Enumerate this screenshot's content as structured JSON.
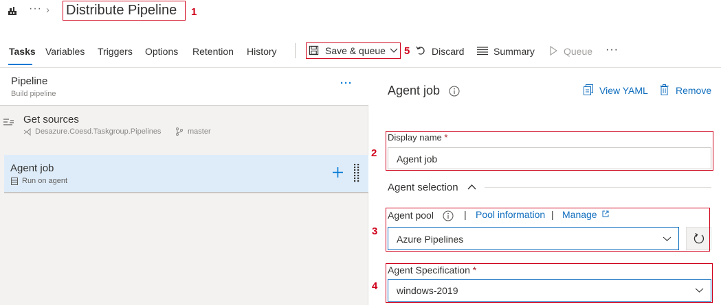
{
  "header": {
    "title": "Distribute Pipeline",
    "more": "···",
    "chevron": "›"
  },
  "tabs": [
    {
      "label": "Tasks",
      "active": true
    },
    {
      "label": "Variables"
    },
    {
      "label": "Triggers"
    },
    {
      "label": "Options"
    },
    {
      "label": "Retention"
    },
    {
      "label": "History"
    }
  ],
  "toolbar": {
    "save_queue": "Save & queue",
    "discard": "Discard",
    "summary": "Summary",
    "queue": "Queue",
    "more": "···"
  },
  "pipeline": {
    "title": "Pipeline",
    "subtitle": "Build pipeline",
    "more": "···"
  },
  "get_sources": {
    "title": "Get sources",
    "repo": "Desazure.Coesd.Taskgroup.Pipelines",
    "branch": "master"
  },
  "agent_job_item": {
    "title": "Agent job",
    "subtitle": "Run on agent"
  },
  "detail": {
    "title": "Agent job",
    "view_yaml": "View YAML",
    "remove": "Remove",
    "display_name_label": "Display name",
    "display_name_value": "Agent job",
    "agent_selection": "Agent selection",
    "agent_pool_label": "Agent pool",
    "pool_information": "Pool information",
    "manage": "Manage",
    "agent_pool_value": "Azure Pipelines",
    "agent_spec_label": "Agent Specification",
    "agent_spec_value": "windows-2019",
    "required_marker": "*",
    "link_sep": "|"
  },
  "callouts": [
    "1",
    "2",
    "3",
    "4",
    "5"
  ],
  "colors": {
    "accent": "#0078d4",
    "annotation": "#d0021b",
    "selected_row": "#deecf9"
  }
}
